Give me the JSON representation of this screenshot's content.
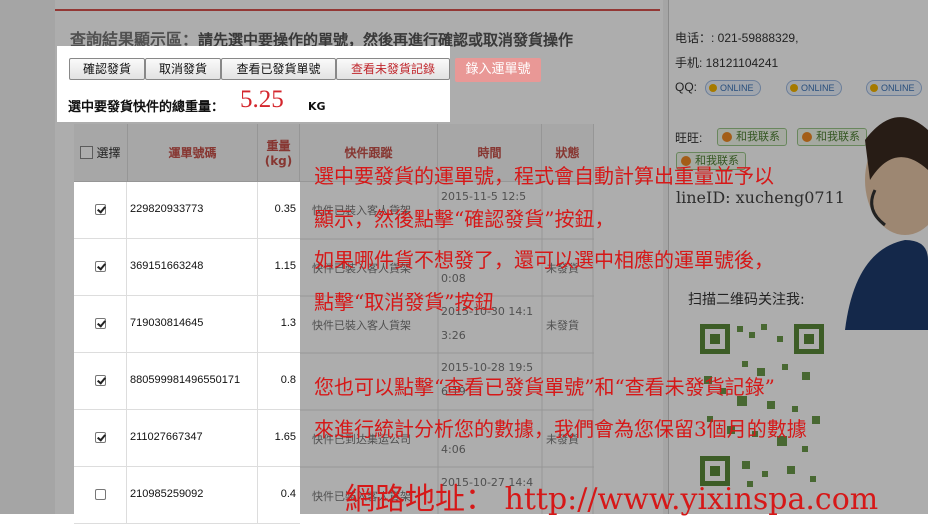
{
  "section": {
    "title": "查詢結果顯示區：",
    "subtitle": "請先選中要操作的單號，然後再進行確認或取消發貨操作"
  },
  "toolbar": {
    "confirm": "確認發貨",
    "cancel": "取消發貨",
    "view_shipped": "查看已發貨單號",
    "view_unshipped": "查看未發貨記錄",
    "entry": "錄入運單號"
  },
  "total": {
    "label": "選中要發貨快件的總重量：",
    "value": "5.25",
    "unit": "KG"
  },
  "table": {
    "headers": {
      "select": "選擇",
      "waybill": "運單號碼",
      "weight": "重量(kg)",
      "tracking": "快件跟蹤",
      "time": "時間",
      "status": "狀態"
    },
    "rows": [
      {
        "checked": true,
        "waybill": "229820933773",
        "weight": "0.35",
        "tracking": "快件已裝入客人貨架",
        "time1": "2015-11-5 12:5",
        "time2": "",
        "status": ""
      },
      {
        "checked": true,
        "waybill": "369151663248",
        "weight": "1.15",
        "tracking": "快件已裝入客人貨架",
        "time1": "",
        "time2": "0:08",
        "status": "未發貨"
      },
      {
        "checked": true,
        "waybill": "719030814645",
        "weight": "1.3",
        "tracking": "快件已裝入客人貨架",
        "time1": "2015-10-30 14:1",
        "time2": "3:26",
        "status": "未發貨"
      },
      {
        "checked": true,
        "waybill": "880599981496550171",
        "weight": "0.8",
        "tracking": "",
        "time1": "2015-10-28 19:5",
        "time2": "6:19",
        "status": ""
      },
      {
        "checked": true,
        "waybill": "211027667347",
        "weight": "1.65",
        "tracking": "快件已到达集运公司",
        "time1": "",
        "time2": "4:06",
        "status": "未發貨"
      },
      {
        "checked": false,
        "waybill": "210985259092",
        "weight": "0.4",
        "tracking": "快件已裝入客人貨架",
        "time1": "2015-10-27 14:4",
        "time2": "",
        "status": ""
      }
    ]
  },
  "sidebar": {
    "phone": "电话：: 021-59888329,",
    "mobile": "手机: 18121104241",
    "qq_label": "QQ:",
    "qq_badge": "ONLINE",
    "ww_label": "旺旺:",
    "ww_badge": "和我联系",
    "line_id": "lineID: xucheng0711",
    "scan": "扫描二维码关注我:"
  },
  "annotations": {
    "line1": "選中要發貨的運單號，程式會自動計算出重量並予以",
    "line2": "顯示，然後點擊“確認發貨”按鈕，",
    "line3": "如果哪件貨不想發了，還可以選中相應的運單號後，",
    "line4": "點擊“取消發貨”按鈕",
    "line5": "您也可以點擊“查看已發貨單號”和“查看未發貨記錄”",
    "line6": "來進行統計分析您的數據，我們會為您保留3個月的數據",
    "url": "網路地址： http://www.yixinspa.com"
  },
  "colors": {
    "accent": "#d61818",
    "button_red_text": "#c0262c"
  }
}
